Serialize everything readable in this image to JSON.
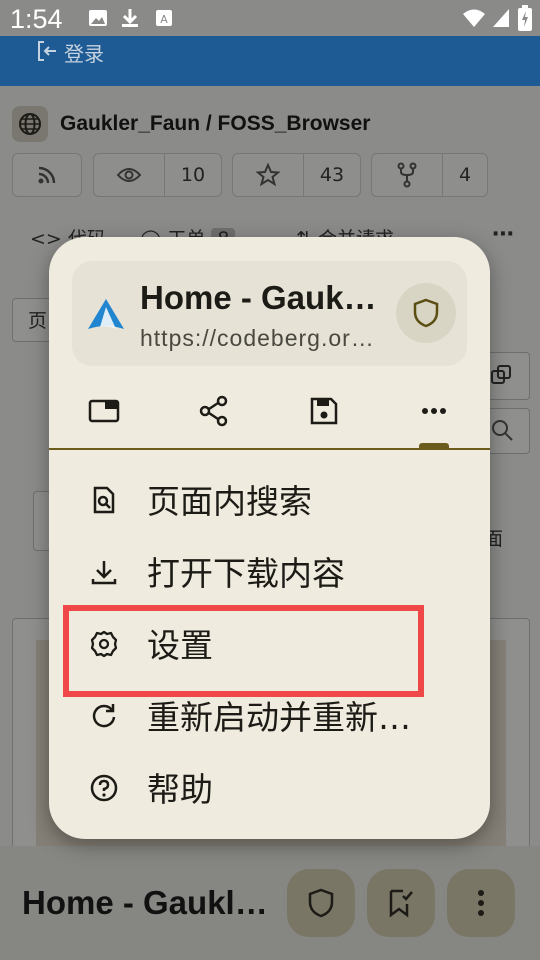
{
  "status_bar": {
    "time": "1:54"
  },
  "background_page": {
    "login_label": "登录",
    "repo_path": "Gaukler_Faun / FOSS_Browser",
    "watchers": "10",
    "stars": "43",
    "forks": "4",
    "tab_code": "代码",
    "tab_issues": "工单",
    "issues_count": "8",
    "tab_pulls": "合并请求",
    "frag_left": "页",
    "frag_right": "面"
  },
  "popup": {
    "title": "Home - Gaukler_Faun/FOSS_Browser",
    "url": "https://codeberg.org/Gaukler_Faun/FOSS_Browser",
    "menu": [
      {
        "label": "页面内搜索",
        "icon": "find-in-page-icon"
      },
      {
        "label": "打开下载内容",
        "icon": "download-icon"
      },
      {
        "label": "设置",
        "icon": "gear-icon"
      },
      {
        "label": "重新启动并重新加载",
        "icon": "refresh-icon"
      },
      {
        "label": "帮助",
        "icon": "help-icon"
      }
    ]
  },
  "bottom_bar": {
    "title": "Home - Gaukler_Faun"
  },
  "colors": {
    "accent": "#6b5c1e",
    "highlight": "#f04848",
    "header_blue": "#1e5a93"
  }
}
